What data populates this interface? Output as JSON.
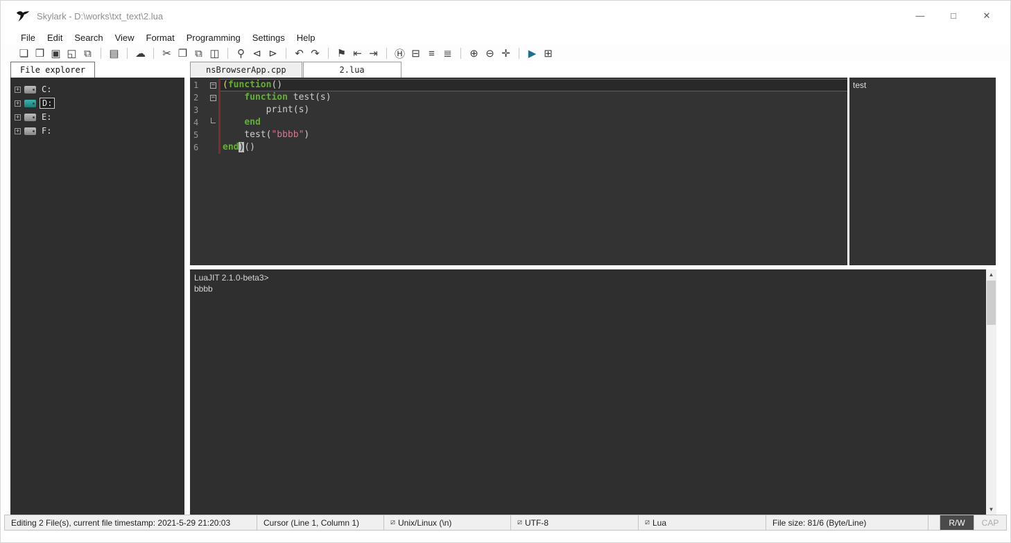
{
  "window": {
    "title": "Skylark - D:\\works\\txt_text\\2.lua",
    "minimize": "—",
    "maximize": "□",
    "close": "✕"
  },
  "menu": {
    "items": [
      "File",
      "Edit",
      "Search",
      "View",
      "Format",
      "Programming",
      "Settings",
      "Help"
    ]
  },
  "toolbar": {
    "groups": [
      [
        {
          "name": "new-file",
          "glyph": "❏"
        },
        {
          "name": "open-file",
          "glyph": "❒"
        },
        {
          "name": "save",
          "glyph": "▣"
        },
        {
          "name": "save-as",
          "glyph": "◱"
        },
        {
          "name": "save-all",
          "glyph": "⧉"
        }
      ],
      [
        {
          "name": "print",
          "glyph": "▤"
        }
      ],
      [
        {
          "name": "remote-cloud",
          "glyph": "☁"
        }
      ],
      [
        {
          "name": "cut",
          "glyph": "✂"
        },
        {
          "name": "copy",
          "glyph": "❐"
        },
        {
          "name": "paste",
          "glyph": "⧉"
        },
        {
          "name": "clipboard",
          "glyph": "◫"
        }
      ],
      [
        {
          "name": "search",
          "glyph": "⚲"
        },
        {
          "name": "find-prev",
          "glyph": "⊲"
        },
        {
          "name": "find-next",
          "glyph": "⊳"
        }
      ],
      [
        {
          "name": "undo",
          "glyph": "↶"
        },
        {
          "name": "redo",
          "glyph": "↷"
        }
      ],
      [
        {
          "name": "bookmark",
          "glyph": "⚑"
        },
        {
          "name": "prev-bookmark",
          "glyph": "⇤"
        },
        {
          "name": "next-bookmark",
          "glyph": "⇥"
        }
      ],
      [
        {
          "name": "hex-view",
          "glyph": "Ⓗ"
        },
        {
          "name": "print-preview",
          "glyph": "⊟"
        },
        {
          "name": "wrap-lines",
          "glyph": "≡"
        },
        {
          "name": "file-info",
          "glyph": "≣"
        }
      ],
      [
        {
          "name": "zoom-in",
          "glyph": "⊕"
        },
        {
          "name": "zoom-out",
          "glyph": "⊖"
        },
        {
          "name": "fullscreen",
          "glyph": "✛"
        }
      ],
      [
        {
          "name": "run-script",
          "glyph": "▶",
          "color": "#1d6e8f"
        },
        {
          "name": "run-terminal",
          "glyph": "⊞"
        }
      ]
    ]
  },
  "explorer": {
    "tab_label": "File explorer",
    "expand_glyph": "+",
    "drives": [
      {
        "label": "C:",
        "selected": false
      },
      {
        "label": "D:",
        "selected": true
      },
      {
        "label": "E:",
        "selected": false
      },
      {
        "label": "F:",
        "selected": false
      }
    ]
  },
  "tabs": [
    {
      "label": "nsBrowserApp.cpp",
      "active": false
    },
    {
      "label": "2.lua",
      "active": true
    }
  ],
  "editor": {
    "fold_collapse_glyph": "−",
    "lines": [
      {
        "num": 1,
        "current": true,
        "fold": "minus",
        "changed": true,
        "tokens": [
          {
            "t": "brace",
            "s": "("
          },
          {
            "t": "kw",
            "s": "function"
          },
          {
            "t": "plain",
            "s": "()"
          }
        ]
      },
      {
        "num": 2,
        "current": false,
        "fold": "minus",
        "changed": true,
        "tokens": [
          {
            "t": "plain",
            "s": "    "
          },
          {
            "t": "kw",
            "s": "function"
          },
          {
            "t": "plain",
            "s": " test(s)"
          }
        ]
      },
      {
        "num": 3,
        "current": false,
        "fold": "",
        "changed": true,
        "tokens": [
          {
            "t": "plain",
            "s": "        print(s)"
          }
        ]
      },
      {
        "num": 4,
        "current": false,
        "fold": "end",
        "changed": true,
        "tokens": [
          {
            "t": "plain",
            "s": "    "
          },
          {
            "t": "kw",
            "s": "end"
          }
        ]
      },
      {
        "num": 5,
        "current": false,
        "fold": "",
        "changed": true,
        "tokens": [
          {
            "t": "plain",
            "s": "    test("
          },
          {
            "t": "str",
            "s": "\"bbbb\""
          },
          {
            "t": "plain",
            "s": ")"
          }
        ]
      },
      {
        "num": 6,
        "current": false,
        "fold": "",
        "changed": true,
        "tokens": [
          {
            "t": "kw",
            "s": "end"
          },
          {
            "t": "cursor",
            "s": ")"
          },
          {
            "t": "plain",
            "s": "()"
          }
        ]
      }
    ]
  },
  "symbols": {
    "items": [
      "test"
    ]
  },
  "console": {
    "lines": [
      "LuaJIT 2.1.0-beta3>",
      "bbbb"
    ]
  },
  "scrollbar": {
    "up": "▲",
    "down": "▼"
  },
  "statusbar": {
    "file_info": "Editing 2 File(s), current file timestamp: 2021-5-29 21:20:03",
    "cursor": "Cursor (Line 1, Column 1)",
    "seg_icon": "⧄",
    "eol": "Unix/Linux (\\n)",
    "encoding": "UTF-8",
    "language": "Lua",
    "file_size": "File size: 81/6 (Byte/Line)",
    "rw": "R/W",
    "cap": "CAP"
  },
  "colors": {
    "keyword_green": "#61b22f",
    "string_pink": "#d8758f",
    "change_marker_red": "#7e2d2d",
    "editor_bg": "#333333",
    "run_button_blue": "#1d6e8f"
  }
}
